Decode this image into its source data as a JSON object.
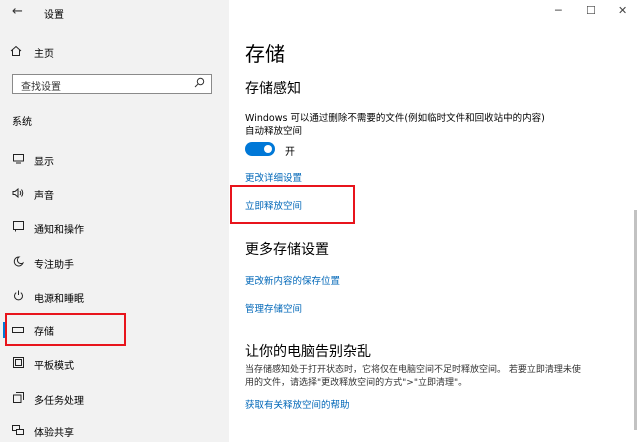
{
  "window": {
    "title": "设置",
    "back_glyph": "←",
    "minimize_glyph": "─",
    "maximize_glyph": "☐",
    "close_glyph": "✕"
  },
  "sidebar": {
    "home_label": "主页",
    "search_placeholder": "查找设置",
    "section_label": "系统",
    "items": [
      {
        "label": "显示",
        "icon": "monitor-icon"
      },
      {
        "label": "声音",
        "icon": "speaker-icon"
      },
      {
        "label": "通知和操作",
        "icon": "notification-icon"
      },
      {
        "label": "专注助手",
        "icon": "moon-icon"
      },
      {
        "label": "电源和睡眠",
        "icon": "power-icon"
      },
      {
        "label": "存储",
        "icon": "storage-icon",
        "active": true
      },
      {
        "label": "平板模式",
        "icon": "tablet-icon"
      },
      {
        "label": "多任务处理",
        "icon": "multitask-icon"
      },
      {
        "label": "体验共享",
        "icon": "share-icon"
      }
    ]
  },
  "main": {
    "title": "存储",
    "storage_sense": {
      "heading": "存储感知",
      "description_line1": "Windows 可以通过删除不需要的文件(例如临时文件和回收站中的内容)",
      "description_line2": "自动释放空间",
      "toggle_state": "开",
      "link_change_settings": "更改详细设置",
      "link_free_now": "立即释放空间"
    },
    "more_settings": {
      "heading": "更多存储设置",
      "link_save_location": "更改新内容的保存位置",
      "link_manage_spaces": "管理存储空间"
    },
    "declutter": {
      "heading": "让你的电脑告别杂乱",
      "text_line1": "当存储感知处于打开状态时，它将仅在电脑空间不足时释放空间。 若要立即清理未使",
      "text_line2": "用的文件，请选择\"更改释放空间的方式\">\"立即清理\"。",
      "link_help": "获取有关释放空间的帮助"
    }
  },
  "colors": {
    "accent": "#0078d7",
    "link": "#0067b8",
    "highlight": "#e8141c",
    "sidebar_bg": "#f2f2f2"
  }
}
